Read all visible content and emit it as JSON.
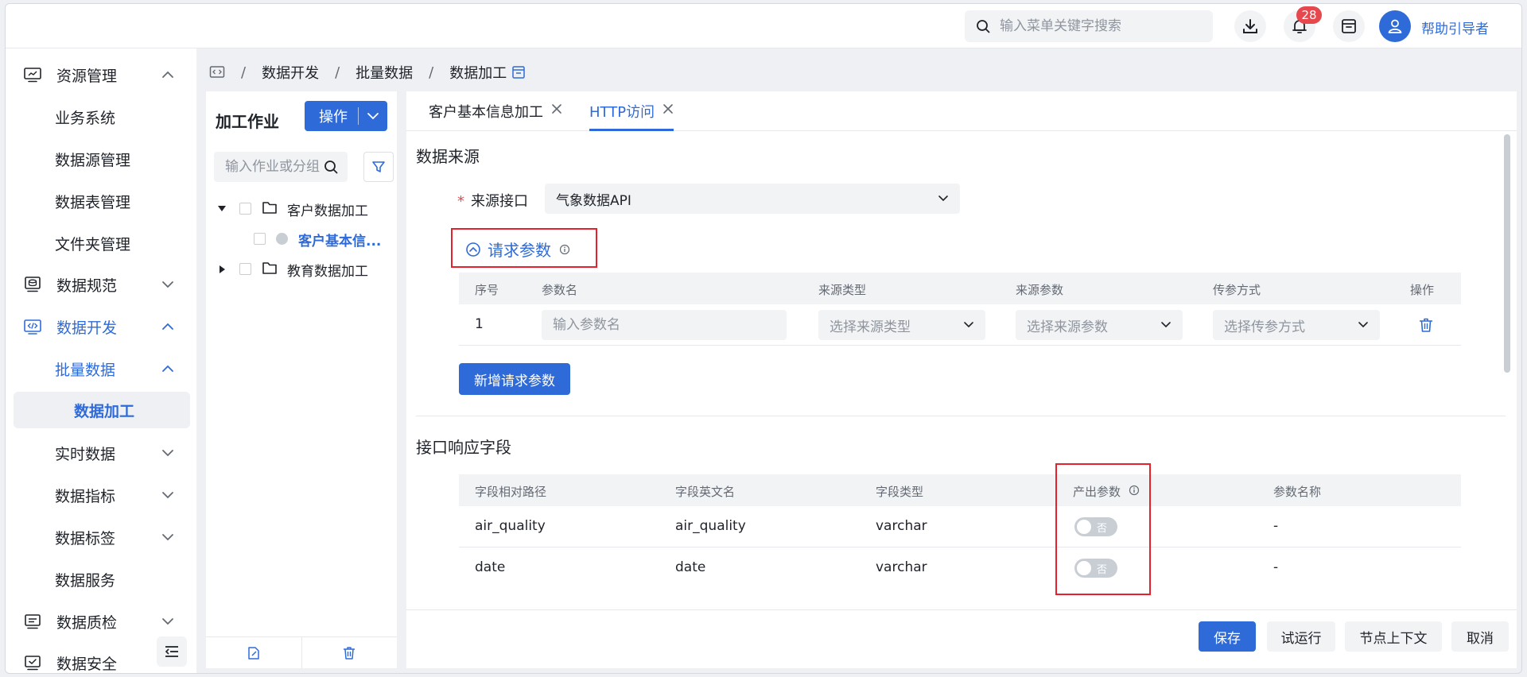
{
  "header": {
    "search_placeholder": "输入菜单关键字搜索",
    "notification_count": "28",
    "username": "帮助引导者"
  },
  "sidebar": {
    "items": [
      {
        "label": "资源管理",
        "icon": "monitor-icon",
        "chevron": "up"
      },
      {
        "label": "业务系统"
      },
      {
        "label": "数据源管理"
      },
      {
        "label": "数据表管理"
      },
      {
        "label": "文件夹管理"
      },
      {
        "label": "数据规范",
        "icon": "database-icon",
        "chevron": "down"
      },
      {
        "label": "数据开发",
        "icon": "code-icon",
        "chevron": "up"
      },
      {
        "label": "批量数据",
        "chevron": "up"
      },
      {
        "label": "数据加工"
      },
      {
        "label": "实时数据",
        "chevron": "down"
      },
      {
        "label": "数据指标",
        "chevron": "down"
      },
      {
        "label": "数据标签",
        "chevron": "down"
      },
      {
        "label": "数据服务"
      },
      {
        "label": "数据质检",
        "icon": "quality-icon",
        "chevron": "down"
      },
      {
        "label": "数据安全",
        "icon": "security-icon"
      }
    ]
  },
  "breadcrumb": [
    "数据开发",
    "批量数据",
    "数据加工"
  ],
  "jobs": {
    "title": "加工作业",
    "op_label": "操作",
    "search_placeholder": "输入作业或分组",
    "tree": [
      {
        "label": "客户数据加工"
      },
      {
        "label": "客户基本信..."
      },
      {
        "label": "教育数据加工"
      }
    ]
  },
  "tabs": [
    {
      "label": "客户基本信息加工"
    },
    {
      "label": "HTTP访问"
    }
  ],
  "source": {
    "title": "数据来源",
    "interface_label": "来源接口",
    "interface_value": "气象数据API",
    "params_title": "请求参数",
    "columns": [
      "序号",
      "参数名",
      "来源类型",
      "来源参数",
      "传参方式",
      "操作"
    ],
    "row": {
      "index": "1",
      "name_placeholder": "输入参数名",
      "type_placeholder": "选择来源类型",
      "param_placeholder": "选择来源参数",
      "method_placeholder": "选择传参方式"
    },
    "add_label": "新增请求参数"
  },
  "response": {
    "title": "接口响应字段",
    "columns": [
      "字段相对路径",
      "字段英文名",
      "字段类型",
      "产出参数",
      "参数名称"
    ],
    "rows": [
      {
        "path": "air_quality",
        "name": "air_quality",
        "type": "varchar",
        "output": "否",
        "param": "-"
      },
      {
        "path": "date",
        "name": "date",
        "type": "varchar",
        "output": "否",
        "param": "-"
      }
    ]
  },
  "footer": {
    "save": "保存",
    "trial": "试运行",
    "context": "节点上下文",
    "cancel": "取消"
  },
  "colors": {
    "primary": "#2f6bd8",
    "highlight_box": "#e5212b",
    "badge": "#e5484d"
  }
}
